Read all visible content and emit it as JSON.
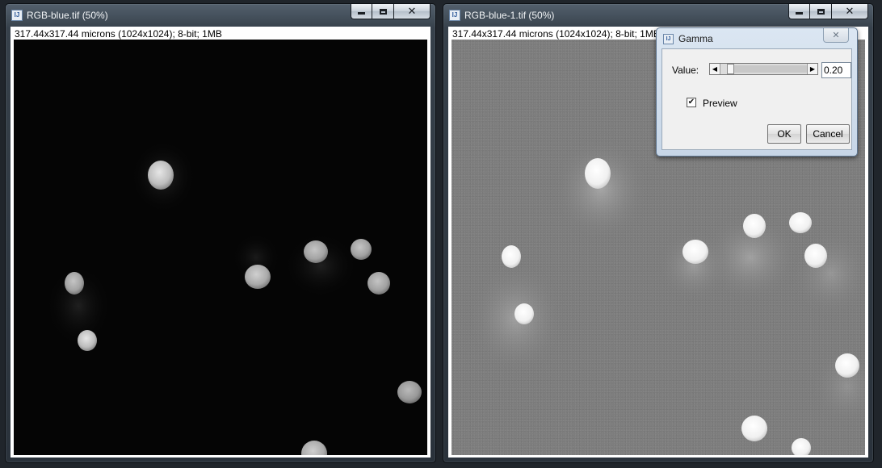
{
  "windows": [
    {
      "title": "RGB-blue.tif (50%)",
      "info": "317.44x317.44 microns (1024x1024); 8-bit; 1MB"
    },
    {
      "title": "RGB-blue-1.tif (50%)",
      "info": "317.44x317.44 microns (1024x1024); 8-bit; 1MB"
    }
  ],
  "icons": {
    "app": "imagej-icon",
    "minimize": "minimize-icon",
    "maximize": "maximize-icon",
    "close": "close-icon",
    "app_glyph": "IJ"
  },
  "gamma_dialog": {
    "title": "Gamma",
    "value_label": "Value:",
    "value": "0.20",
    "slider_position": 0.08,
    "preview_label": "Preview",
    "preview_checked": true,
    "ok_label": "OK",
    "cancel_label": "Cancel"
  },
  "colors": {
    "original_background": "#050505",
    "gamma_background": "#7d7d7d"
  }
}
